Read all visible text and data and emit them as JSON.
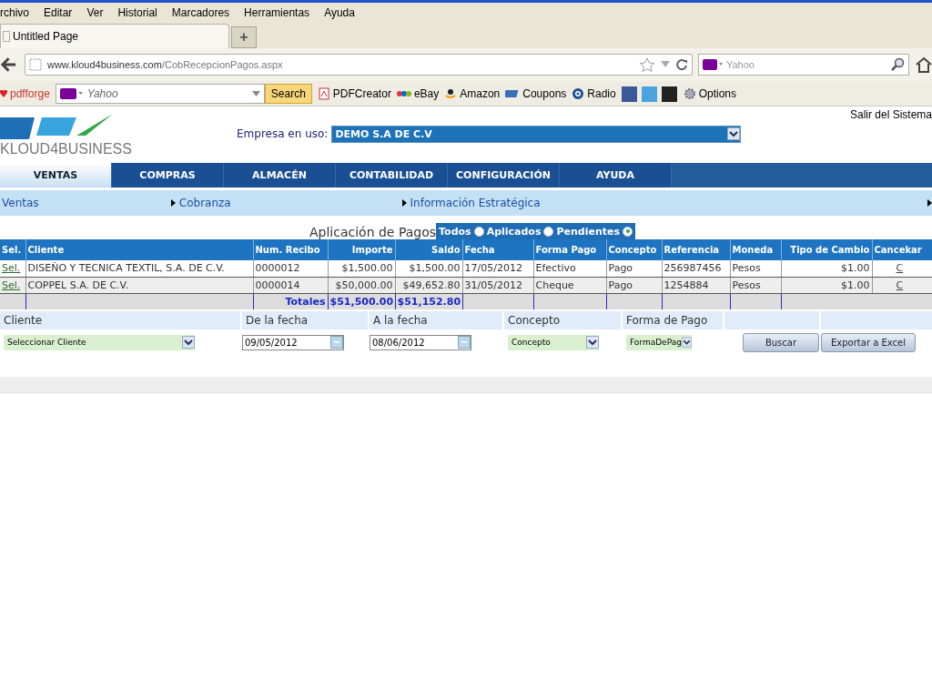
{
  "menu": [
    "rchivo",
    "Editar",
    "Ver",
    "Historial",
    "Marcadores",
    "Herramientas",
    "Ayuda"
  ],
  "tab": {
    "title": "Untitled Page",
    "new_tab": "+"
  },
  "address": {
    "host": "www.kloud4business.com",
    "path": "/CobRecepcionPagos.aspx",
    "search_placeholder": "Yahoo"
  },
  "bookmarks": {
    "brand": "pdfforge",
    "search_placeholder": "Yahoo",
    "search_button": "Search",
    "items": [
      {
        "label": "PDFCreator",
        "kind": "pdf"
      },
      {
        "label": "eBay",
        "kind": "ebay"
      },
      {
        "label": "Amazon",
        "kind": "amazon"
      },
      {
        "label": "Coupons",
        "kind": "coupons"
      },
      {
        "label": "Radio",
        "kind": "radio"
      }
    ],
    "options": "Options"
  },
  "header": {
    "logo": "KLOUD4BUSINESS",
    "company_label": "Empresa en uso:",
    "company_value": "DEMO S.A DE C.V",
    "logout": "Salir del Sistema"
  },
  "main_tabs": [
    {
      "label": "VENTAS",
      "selected": true
    },
    {
      "label": "COMPRAS",
      "selected": false
    },
    {
      "label": "ALMACÉN",
      "selected": false
    },
    {
      "label": "CONTABILIDAD",
      "selected": false
    },
    {
      "label": "CONFIGURACIÓN",
      "selected": false
    },
    {
      "label": "AYUDA",
      "selected": false
    }
  ],
  "sub_menu": [
    {
      "label": "Ventas",
      "arrow": false
    },
    {
      "label": "Cobranza",
      "arrow": true
    },
    {
      "label": "Información Estratégica",
      "arrow": true
    }
  ],
  "filter": {
    "title": "Aplicación de Pagos",
    "options": [
      {
        "label": "Todos",
        "selected": false
      },
      {
        "label": "Aplicados",
        "selected": false
      },
      {
        "label": "Pendientes",
        "selected": true
      }
    ]
  },
  "table": {
    "columns": [
      "Sel.",
      "Cliente",
      "Num. Recibo",
      "Importe",
      "Saldo",
      "Fecha",
      "Forma Pago",
      "Concepto",
      "Referencia",
      "Moneda",
      "Tipo de Cambio",
      "Cancekar"
    ],
    "rows": [
      [
        "Sel.",
        "DISEÑO Y TECNICA TEXTIL, S.A. DE C.V.",
        "0000012",
        "$1,500.00",
        "$1,500.00",
        "17/05/2012",
        "Efectivo",
        "Pago",
        "256987456",
        "Pesos",
        "$1.00",
        "C"
      ],
      [
        "Sel.",
        "COPPEL S.A.  DE C.V.",
        "0000014",
        "$50,000.00",
        "$49,652.80",
        "31/05/2012",
        "Cheque",
        "Pago",
        "1254884",
        "Pesos",
        "$1.00",
        "C"
      ]
    ],
    "totals": {
      "label": "Totales",
      "importe": "$51,500.00",
      "saldo": "$51,152.80"
    }
  },
  "search": {
    "cliente_label": "Cliente",
    "cliente_value": "Seleccionar Cliente",
    "from_label": "De la fecha",
    "from_value": "09/05/2012",
    "to_label": "A la fecha",
    "to_value": "08/06/2012",
    "concepto_label": "Concepto",
    "concepto_value": "Concepto",
    "forma_label": "Forma de Pago",
    "forma_value": "FormaDePag",
    "buscar": "Buscar",
    "exportar": "Exportar a Excel"
  }
}
